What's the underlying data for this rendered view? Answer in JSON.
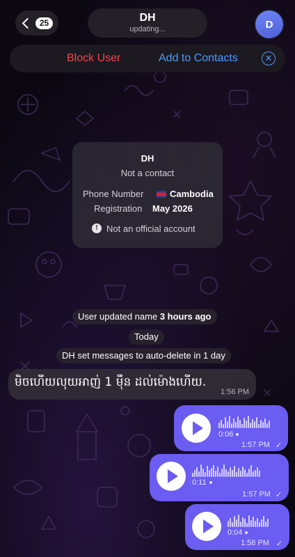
{
  "header": {
    "back_count": "25",
    "contact_name": "DH",
    "status": "updating...",
    "avatar_initial": "D"
  },
  "action_bar": {
    "block_label": "Block User",
    "add_label": "Add to Contacts",
    "close_icon": "close-circle-icon"
  },
  "info_card": {
    "name": "DH",
    "subtitle": "Not a contact",
    "phone_label": "Phone Number",
    "phone_value": "Cambodia",
    "registration_label": "Registration",
    "registration_value": "May 2026",
    "warning": "Not an official account"
  },
  "service_messages": {
    "name_update": "User updated name",
    "name_update_time": "3 hours ago",
    "date_divider": "Today",
    "auto_delete": "DH set messages to auto-delete in 1 day"
  },
  "messages": {
    "incoming_text": "មិចហើយលុយអាញ់ 1 ម៉ឺន ដល់ម៉ោងហើយ.",
    "incoming_time": "1:56 PM",
    "voice": [
      {
        "duration": "0:06",
        "time": "1:57 PM",
        "ticks": "✓"
      },
      {
        "duration": "0:11",
        "time": "1:57 PM",
        "ticks": "✓"
      },
      {
        "duration": "0:04",
        "time": "1:58 PM",
        "ticks": "✓"
      }
    ]
  },
  "colors": {
    "accent_blue": "#4c9bff",
    "danger_red": "#f0484a",
    "outgoing_bubble": "#6b5cf2",
    "avatar": "#5a6fe6"
  }
}
